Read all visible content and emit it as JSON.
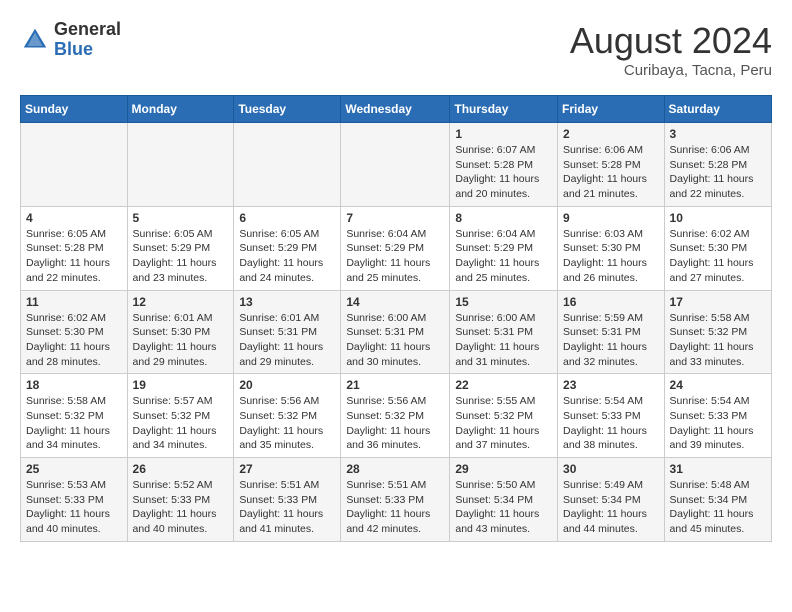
{
  "header": {
    "logo_general": "General",
    "logo_blue": "Blue",
    "title": "August 2024",
    "subtitle": "Curibaya, Tacna, Peru"
  },
  "days_of_week": [
    "Sunday",
    "Monday",
    "Tuesday",
    "Wednesday",
    "Thursday",
    "Friday",
    "Saturday"
  ],
  "weeks": [
    [
      {
        "day": "",
        "info": ""
      },
      {
        "day": "",
        "info": ""
      },
      {
        "day": "",
        "info": ""
      },
      {
        "day": "",
        "info": ""
      },
      {
        "day": "1",
        "info": "Sunrise: 6:07 AM\nSunset: 5:28 PM\nDaylight: 11 hours and 20 minutes."
      },
      {
        "day": "2",
        "info": "Sunrise: 6:06 AM\nSunset: 5:28 PM\nDaylight: 11 hours and 21 minutes."
      },
      {
        "day": "3",
        "info": "Sunrise: 6:06 AM\nSunset: 5:28 PM\nDaylight: 11 hours and 22 minutes."
      }
    ],
    [
      {
        "day": "4",
        "info": "Sunrise: 6:05 AM\nSunset: 5:28 PM\nDaylight: 11 hours and 22 minutes."
      },
      {
        "day": "5",
        "info": "Sunrise: 6:05 AM\nSunset: 5:29 PM\nDaylight: 11 hours and 23 minutes."
      },
      {
        "day": "6",
        "info": "Sunrise: 6:05 AM\nSunset: 5:29 PM\nDaylight: 11 hours and 24 minutes."
      },
      {
        "day": "7",
        "info": "Sunrise: 6:04 AM\nSunset: 5:29 PM\nDaylight: 11 hours and 25 minutes."
      },
      {
        "day": "8",
        "info": "Sunrise: 6:04 AM\nSunset: 5:29 PM\nDaylight: 11 hours and 25 minutes."
      },
      {
        "day": "9",
        "info": "Sunrise: 6:03 AM\nSunset: 5:30 PM\nDaylight: 11 hours and 26 minutes."
      },
      {
        "day": "10",
        "info": "Sunrise: 6:02 AM\nSunset: 5:30 PM\nDaylight: 11 hours and 27 minutes."
      }
    ],
    [
      {
        "day": "11",
        "info": "Sunrise: 6:02 AM\nSunset: 5:30 PM\nDaylight: 11 hours and 28 minutes."
      },
      {
        "day": "12",
        "info": "Sunrise: 6:01 AM\nSunset: 5:30 PM\nDaylight: 11 hours and 29 minutes."
      },
      {
        "day": "13",
        "info": "Sunrise: 6:01 AM\nSunset: 5:31 PM\nDaylight: 11 hours and 29 minutes."
      },
      {
        "day": "14",
        "info": "Sunrise: 6:00 AM\nSunset: 5:31 PM\nDaylight: 11 hours and 30 minutes."
      },
      {
        "day": "15",
        "info": "Sunrise: 6:00 AM\nSunset: 5:31 PM\nDaylight: 11 hours and 31 minutes."
      },
      {
        "day": "16",
        "info": "Sunrise: 5:59 AM\nSunset: 5:31 PM\nDaylight: 11 hours and 32 minutes."
      },
      {
        "day": "17",
        "info": "Sunrise: 5:58 AM\nSunset: 5:32 PM\nDaylight: 11 hours and 33 minutes."
      }
    ],
    [
      {
        "day": "18",
        "info": "Sunrise: 5:58 AM\nSunset: 5:32 PM\nDaylight: 11 hours and 34 minutes."
      },
      {
        "day": "19",
        "info": "Sunrise: 5:57 AM\nSunset: 5:32 PM\nDaylight: 11 hours and 34 minutes."
      },
      {
        "day": "20",
        "info": "Sunrise: 5:56 AM\nSunset: 5:32 PM\nDaylight: 11 hours and 35 minutes."
      },
      {
        "day": "21",
        "info": "Sunrise: 5:56 AM\nSunset: 5:32 PM\nDaylight: 11 hours and 36 minutes."
      },
      {
        "day": "22",
        "info": "Sunrise: 5:55 AM\nSunset: 5:32 PM\nDaylight: 11 hours and 37 minutes."
      },
      {
        "day": "23",
        "info": "Sunrise: 5:54 AM\nSunset: 5:33 PM\nDaylight: 11 hours and 38 minutes."
      },
      {
        "day": "24",
        "info": "Sunrise: 5:54 AM\nSunset: 5:33 PM\nDaylight: 11 hours and 39 minutes."
      }
    ],
    [
      {
        "day": "25",
        "info": "Sunrise: 5:53 AM\nSunset: 5:33 PM\nDaylight: 11 hours and 40 minutes."
      },
      {
        "day": "26",
        "info": "Sunrise: 5:52 AM\nSunset: 5:33 PM\nDaylight: 11 hours and 40 minutes."
      },
      {
        "day": "27",
        "info": "Sunrise: 5:51 AM\nSunset: 5:33 PM\nDaylight: 11 hours and 41 minutes."
      },
      {
        "day": "28",
        "info": "Sunrise: 5:51 AM\nSunset: 5:33 PM\nDaylight: 11 hours and 42 minutes."
      },
      {
        "day": "29",
        "info": "Sunrise: 5:50 AM\nSunset: 5:34 PM\nDaylight: 11 hours and 43 minutes."
      },
      {
        "day": "30",
        "info": "Sunrise: 5:49 AM\nSunset: 5:34 PM\nDaylight: 11 hours and 44 minutes."
      },
      {
        "day": "31",
        "info": "Sunrise: 5:48 AM\nSunset: 5:34 PM\nDaylight: 11 hours and 45 minutes."
      }
    ]
  ]
}
